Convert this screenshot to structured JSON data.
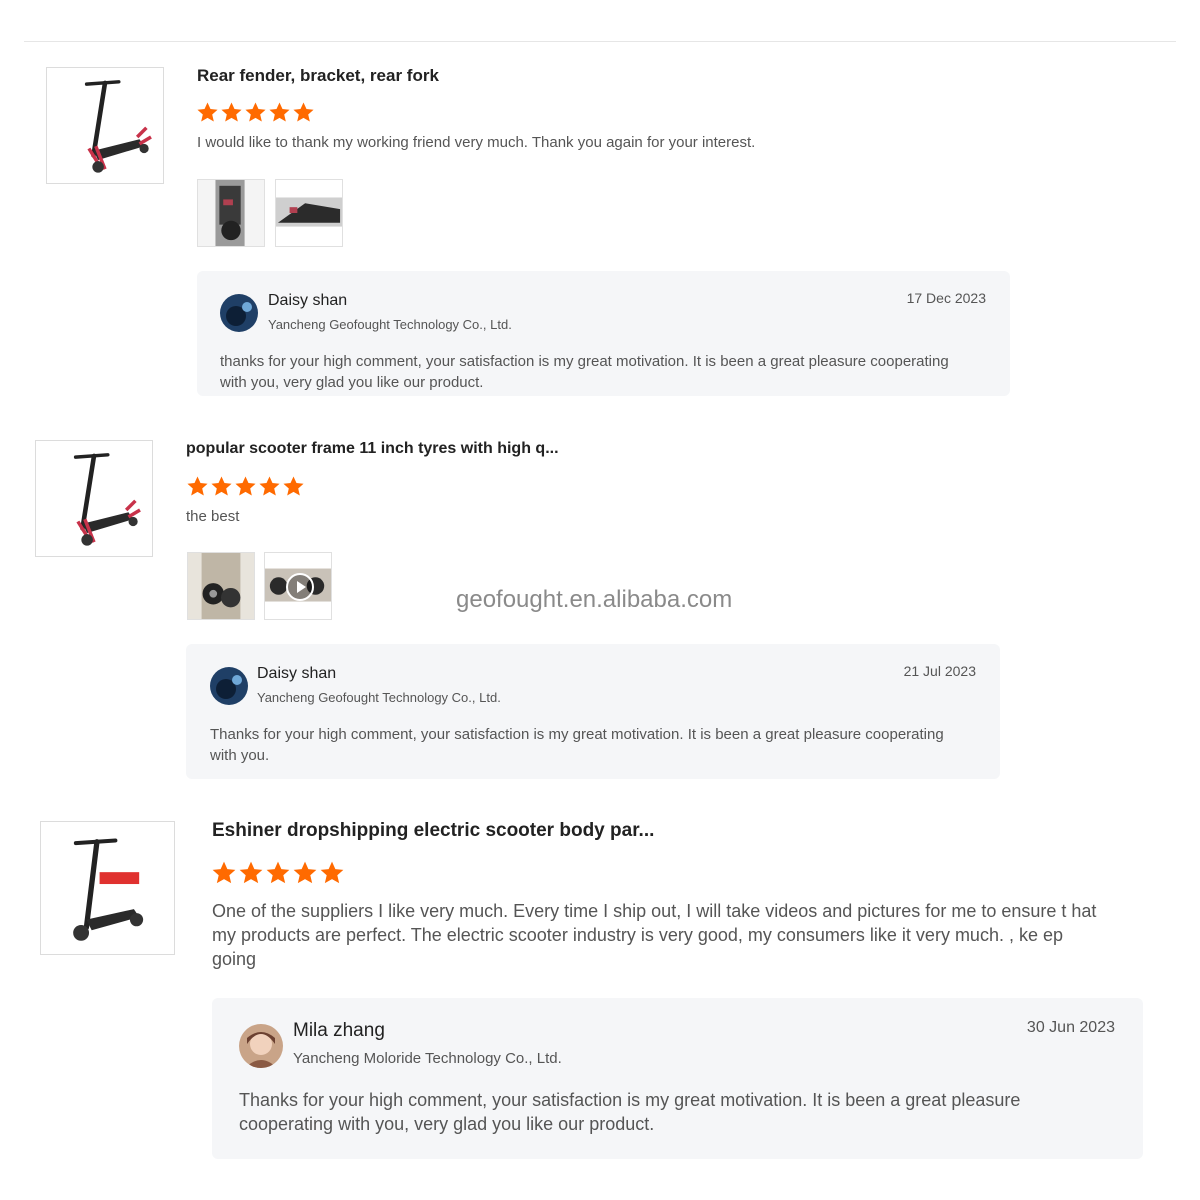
{
  "watermark": "geofought.en.alibaba.com",
  "colors": {
    "star": "#ff6a00",
    "reply_bg": "#f5f6f8",
    "divider": "#e6e6e6"
  },
  "reviews": [
    {
      "product_title": "Rear fender, bracket, rear fork",
      "rating": 5,
      "text": "I would like to thank my working friend very much.  Thank you again for your interest.",
      "photos": [
        {
          "kind": "photo"
        },
        {
          "kind": "photo"
        }
      ],
      "reply": {
        "name": "Daisy shan",
        "company": "Yancheng Geofought Technology Co., Ltd.",
        "date": "17 Dec 2023",
        "text": "thanks for your high comment, your satisfaction is my great motivation. It is been a great pleasure cooperating with you, very glad you like our product."
      }
    },
    {
      "product_title": "popular scooter frame 11 inch tyres with high q...",
      "rating": 5,
      "text": "the best",
      "photos": [
        {
          "kind": "photo"
        },
        {
          "kind": "video",
          "icon": "play-icon"
        }
      ],
      "reply": {
        "name": "Daisy shan",
        "company": "Yancheng Geofought Technology Co., Ltd.",
        "date": "21 Jul 2023",
        "text": "Thanks for your high comment, your satisfaction is my great motivation. It is been a great pleasure cooperating with you."
      }
    },
    {
      "product_title": "Eshiner dropshipping electric scooter body par...",
      "rating": 5,
      "text": "One of the suppliers I like very much. Every time I ship out, I will take videos and pictures for me to ensure t hat my products are perfect. The electric scooter industry is very good, my consumers like it very much. , ke ep going",
      "photos": [],
      "reply": {
        "name": "Mila zhang",
        "company": "Yancheng Moloride Technology Co., Ltd.",
        "date": "30 Jun 2023",
        "text": "Thanks for your high comment, your satisfaction is my great motivation. It is been a great pleasure cooperating with you, very glad you like our product."
      }
    }
  ]
}
